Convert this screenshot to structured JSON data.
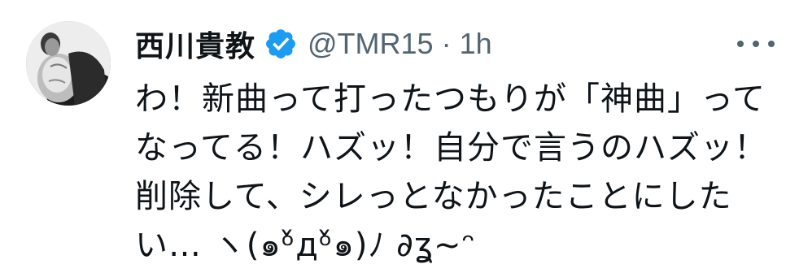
{
  "tweet": {
    "author": {
      "display_name": "西川貴教",
      "handle": "@TMR15",
      "verified_icon": "verified-badge-icon",
      "avatar_icon": "profile-photo"
    },
    "separator": "·",
    "timestamp": "1h",
    "more_icon": "more-options-icon",
    "text": "わ！新曲って打ったつもりが「神曲」って\nなってる！ハズッ！自分で言うのハズッ！\n削除して、シレっとなかったことにした\nい… ヽ(๑ᵒ̌дᵒ̌๑)ﾉ ∂ʓ~ᵔ",
    "colors": {
      "name": "#0f1419",
      "meta": "#536471",
      "verified": "#1d9bf0"
    }
  }
}
